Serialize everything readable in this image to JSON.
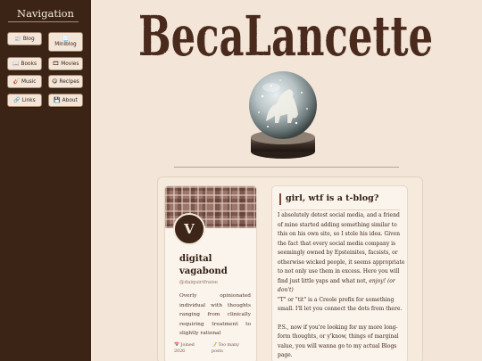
{
  "sidebar": {
    "title": "Navigation",
    "items": [
      {
        "label": "Blog",
        "icon": "📰"
      },
      {
        "label": "Miniblog",
        "icon": "📃"
      },
      {
        "label": "Books",
        "icon": "📖"
      },
      {
        "label": "Movies",
        "icon": "🎞"
      },
      {
        "label": "Music",
        "icon": "🎸"
      },
      {
        "label": "Recipes",
        "icon": "😋"
      },
      {
        "label": "Links",
        "icon": "🔗"
      },
      {
        "label": "About",
        "icon": "💾"
      }
    ]
  },
  "header": {
    "site_title": "BecaLancette"
  },
  "profile": {
    "avatar_letter": "V",
    "name": "digital vagabond",
    "handle": "@daiquirifraise",
    "bio": "Overly opinionated individual with thoughts ranging from clinically requiring treatment to slightly rational",
    "joined_icon": "📅",
    "joined_label": "Joined",
    "joined_year": "2026",
    "posts_icon": "📝",
    "posts_label": "Too many",
    "posts_label2": "posts"
  },
  "post": {
    "title": "girl, wtf is a t-blog?",
    "p1": "I absolutely detest social media, and a friend of mine started adding something similar to this on his own site, so I stole his idea. Given the fact that every social media company is seemingly owned by Epsteinites, facsists, or otherwise wicked people, it seems appropriate to not only use them in excess. Here you will find just little yaps and what not,",
    "p1_em": "enjoy! (or don't)",
    "p2": "\"T\" or \"tit\" is a Creole prefix for something small. I'll let you connect the dots from there.",
    "p3": "P.S., now if you're looking for my more long-form thoughts, or y'know, things of marginal value, you will wanna go to my actual Blogs page."
  },
  "colors": {
    "sidebar_bg": "#3b2416",
    "page_bg": "#f3e6d9",
    "accent": "#4a2c1a"
  }
}
